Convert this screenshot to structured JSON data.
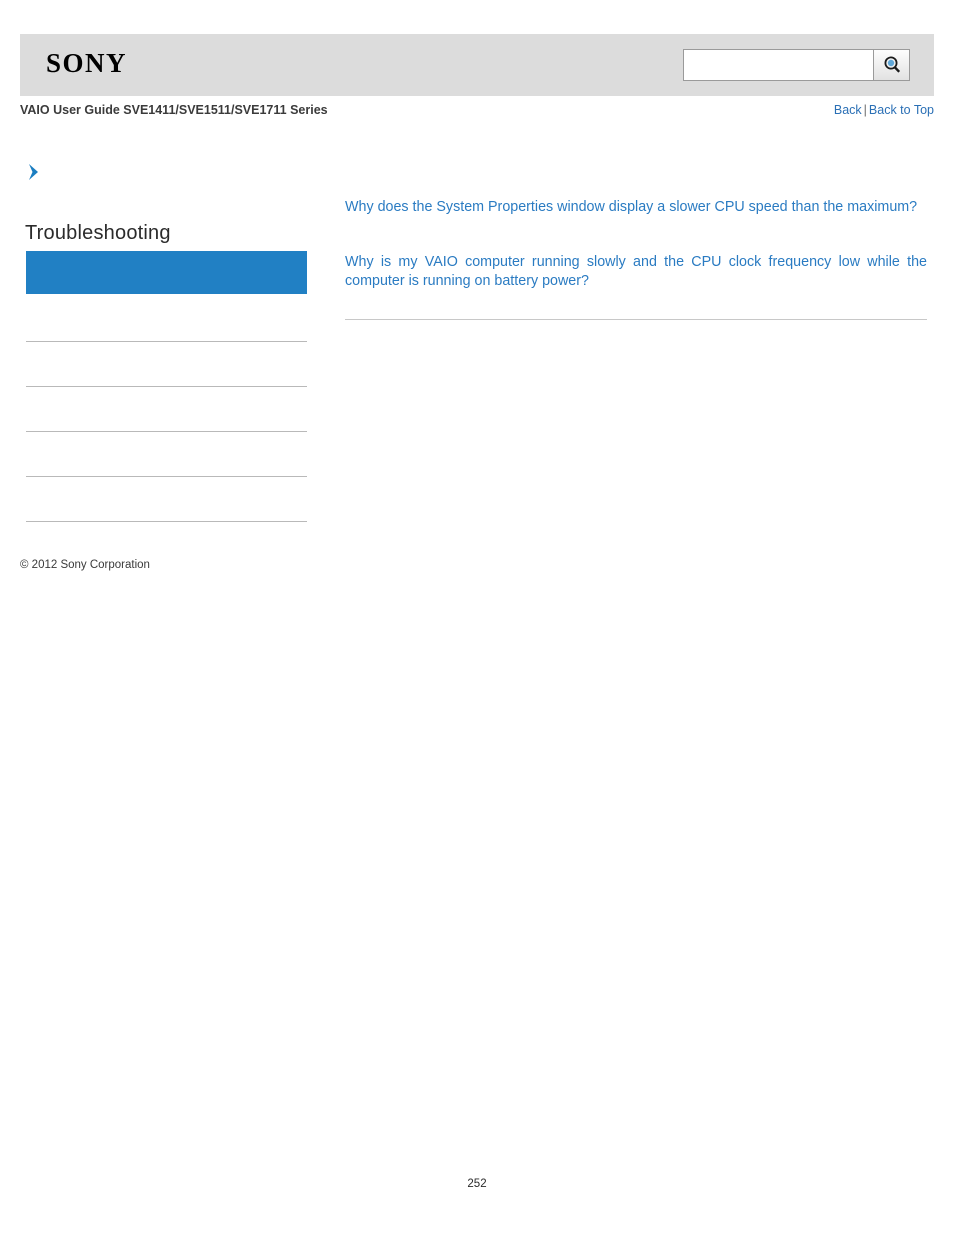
{
  "header": {
    "logo_text": "SONY",
    "search": {
      "value": "",
      "placeholder": "",
      "button_icon": "search-icon"
    }
  },
  "document": {
    "title": "VAIO User Guide SVE1411/SVE1511/SVE1711 Series",
    "nav": {
      "back_label": "Back",
      "separator": "|",
      "back_to_top_label": "Back to Top"
    },
    "page_number": "252",
    "copyright": "© 2012 Sony Corporation"
  },
  "sidebar": {
    "arrow_icon": "chevron-right-icon",
    "heading": "Troubleshooting",
    "active_item_label": "",
    "items": [
      {
        "label": ""
      },
      {
        "label": ""
      },
      {
        "label": ""
      },
      {
        "label": ""
      },
      {
        "label": ""
      }
    ]
  },
  "main": {
    "links": [
      {
        "text": "Why does the System Properties window display a slower CPU speed than the maximum?",
        "color": "#2a7bc2"
      },
      {
        "text": "Why is my VAIO computer running slowly and the CPU clock frequency low while the computer is running on battery power?",
        "color": "#2a7bc2"
      }
    ]
  },
  "colors": {
    "header_bg": "#dcdcdc",
    "accent": "#2180c4",
    "link": "#2a7bc2"
  }
}
